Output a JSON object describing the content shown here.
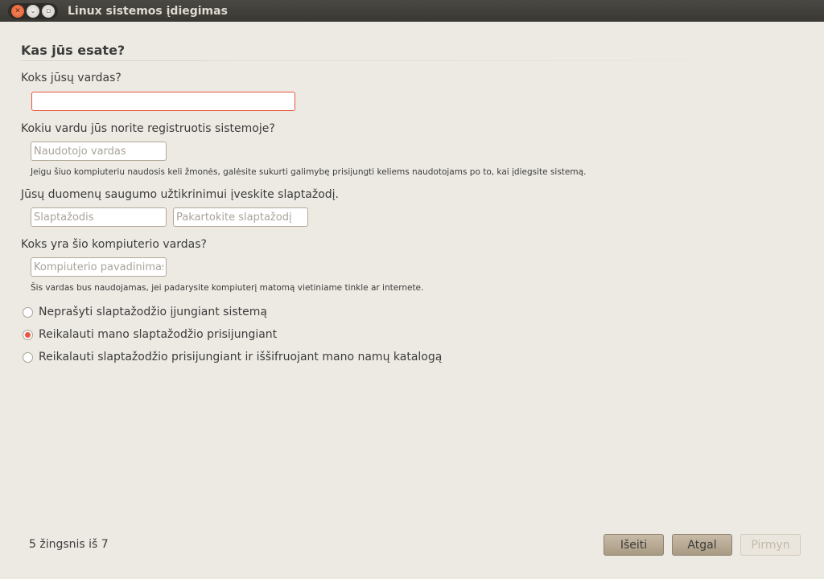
{
  "window": {
    "title": "Linux sistemos įdiegimas"
  },
  "page": {
    "heading": "Kas jūs esate?"
  },
  "form": {
    "name_label": "Koks jūsų vardas?",
    "name_value": "",
    "username_label": "Kokiu vardu jūs norite registruotis sistemoje?",
    "username_placeholder": "Naudotojo vardas",
    "username_hint": "Jeigu šiuo kompiuteriu naudosis keli žmonės, galėsite sukurti galimybę prisijungti keliems naudotojams po to, kai įdiegsite sistemą.",
    "password_label": "Jūsų duomenų saugumo užtikrinimui įveskite slaptažodį.",
    "password_placeholder": "Slaptažodis",
    "confirm_placeholder": "Pakartokite slaptažodį",
    "hostname_label": "Koks yra šio kompiuterio vardas?",
    "hostname_placeholder": "Kompiuterio pavadinimas",
    "hostname_hint": "Šis vardas bus naudojamas, jei padarysite kompiuterį matomą vietiniame tinkle ar internete.",
    "login_options": [
      {
        "label": "Neprašyti slaptažodžio įjungiant sistemą",
        "selected": false
      },
      {
        "label": "Reikalauti mano slaptažodžio prisijungiant",
        "selected": true
      },
      {
        "label": "Reikalauti slaptažodžio prisijungiant ir iššifruojant mano namų katalogą",
        "selected": false
      }
    ]
  },
  "footer": {
    "step": "5 žingsnis iš 7",
    "quit": "Išeiti",
    "back": "Atgal",
    "forward": "Pirmyn"
  },
  "colors": {
    "accent": "#e9573f",
    "background": "#edeae3"
  }
}
